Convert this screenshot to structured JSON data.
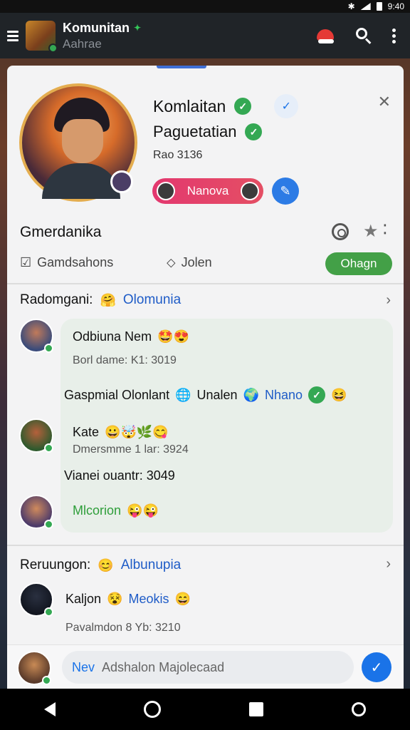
{
  "status": {
    "time": "9:40"
  },
  "appbar": {
    "title": "Komunitan",
    "subtitle": "Aahrae"
  },
  "profile": {
    "name": "Komlaitan",
    "role": "Paguetatian",
    "rank": "Rao 3136",
    "pill_label": "Nanova",
    "group_name": "Gmerdanika",
    "stat_members": "Gamdsahons",
    "stat_join": "Jolen",
    "join_button": "Ohagn"
  },
  "section1": {
    "heading": "Radomgani:",
    "tag": "Olomunia",
    "messages": [
      {
        "author": "Odbiuna Nem",
        "emoji": "🤩😍",
        "meta": "Borl dame: K1: 3019"
      },
      {
        "line": "Gaspmial Olonlant",
        "mention1": "Unalen",
        "mention2": "Nhano",
        "emoji": "😆"
      },
      {
        "author": "Kate",
        "emoji": "😀🤯🌿😋",
        "meta": "Dmersmme 1 lar: 3924"
      },
      {
        "line": "Vianei ouantr: 3049"
      },
      {
        "line": "Mlcorion",
        "emoji": "😜😜"
      }
    ]
  },
  "section2": {
    "heading": "Reruungon:",
    "tag": "Albunupia",
    "messages": [
      {
        "author": "Kaljon",
        "mention": "Meokis",
        "emoji": "😄"
      },
      {
        "line": "Pavalmdon 8 Yb: 3210"
      }
    ]
  },
  "composer": {
    "tag": "Nev",
    "placeholder": "Adshalon Majolecaad"
  }
}
